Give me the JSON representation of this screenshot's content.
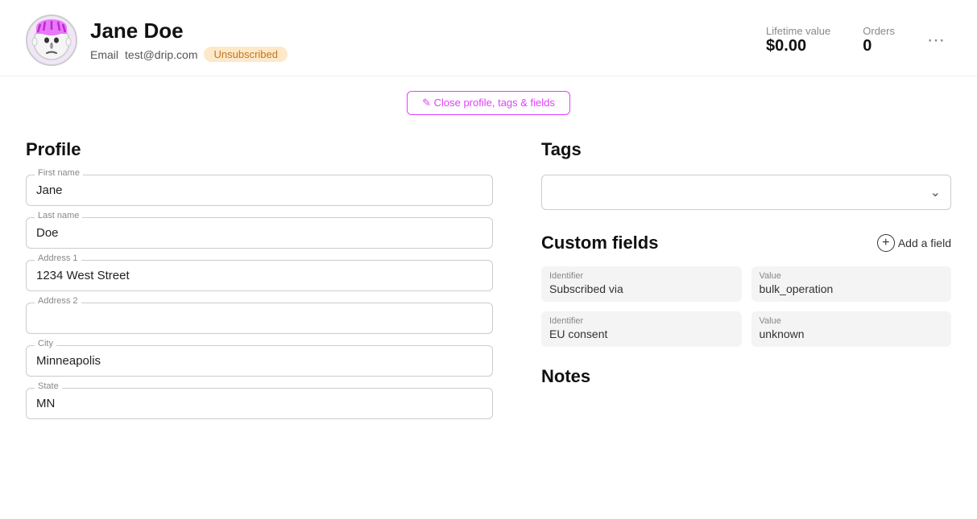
{
  "header": {
    "user_name": "Jane Doe",
    "email_label": "Email",
    "email_value": "test@drip.com",
    "badge": "Unsubscribed",
    "lifetime_value_label": "Lifetime value",
    "lifetime_value": "$0.00",
    "orders_label": "Orders",
    "orders_value": "0",
    "more_icon": "⋯"
  },
  "close_bar": {
    "button_label": "✎ Close profile, tags & fields"
  },
  "profile": {
    "section_title": "Profile",
    "fields": [
      {
        "label": "First name",
        "value": "Jane",
        "name": "first-name"
      },
      {
        "label": "Last name",
        "value": "Doe",
        "name": "last-name"
      },
      {
        "label": "Address 1",
        "value": "1234 West Street",
        "name": "address1"
      },
      {
        "label": "Address 2",
        "value": "",
        "name": "address2"
      },
      {
        "label": "City",
        "value": "Minneapolis",
        "name": "city"
      },
      {
        "label": "State",
        "value": "MN",
        "name": "state"
      }
    ]
  },
  "tags": {
    "section_title": "Tags",
    "dropdown_placeholder": ""
  },
  "custom_fields": {
    "section_title": "Custom fields",
    "add_button_label": "Add a field",
    "rows": [
      {
        "identifier_label": "Identifier",
        "identifier_value": "Subscribed via",
        "value_label": "Value",
        "value_value": "bulk_operation"
      },
      {
        "identifier_label": "Identifier",
        "identifier_value": "EU consent",
        "value_label": "Value",
        "value_value": "unknown"
      }
    ]
  },
  "notes": {
    "section_title": "Notes"
  }
}
